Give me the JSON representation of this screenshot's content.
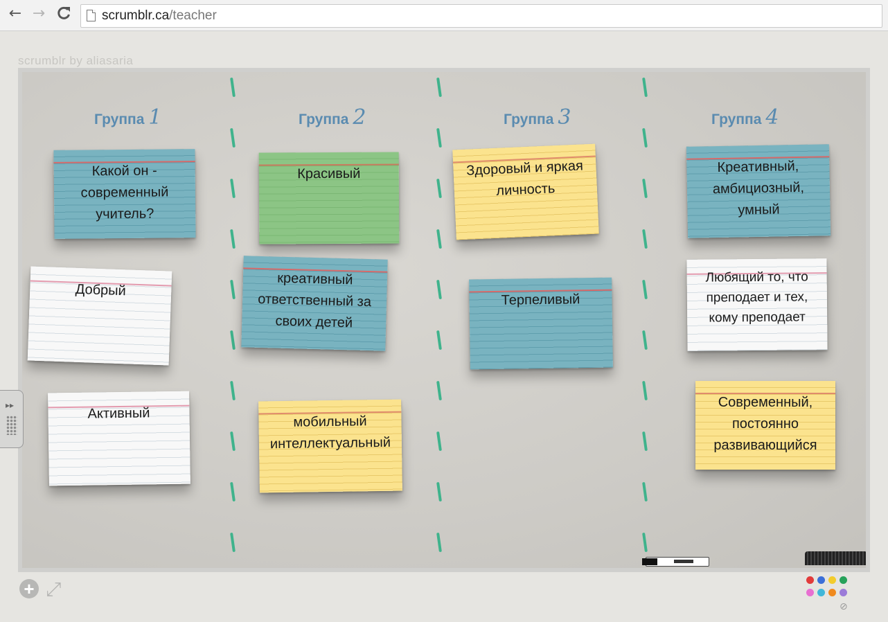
{
  "browser": {
    "url_host": "scrumblr.ca",
    "url_path": "/teacher",
    "back": "←",
    "forward": "→",
    "reload": "C"
  },
  "app": {
    "brand": "scrumblr by aliasaria"
  },
  "columns": [
    {
      "label": "Группа",
      "number": "1"
    },
    {
      "label": "Группа",
      "number": "2"
    },
    {
      "label": "Группа",
      "number": "3"
    },
    {
      "label": "Группа",
      "number": "4"
    }
  ],
  "cards": [
    {
      "color": "blue",
      "lines": [
        "Какой он -",
        "современный",
        "учитель?"
      ]
    },
    {
      "color": "white",
      "lines": [
        "Добрый"
      ]
    },
    {
      "color": "white",
      "lines": [
        "Активный"
      ]
    },
    {
      "color": "green",
      "lines": [
        "Красивый"
      ]
    },
    {
      "color": "blue",
      "lines": [
        "креативный",
        "ответственный за",
        "своих детей"
      ]
    },
    {
      "color": "yellow",
      "lines": [
        "мобильный",
        "интеллектуальный"
      ]
    },
    {
      "color": "yellow",
      "lines": [
        "Здоровый и яркая",
        "личность"
      ]
    },
    {
      "color": "blue",
      "lines": [
        "Терпеливый"
      ]
    },
    {
      "color": "blue",
      "lines": [
        "Креативный,",
        "амбициозный,",
        "умный"
      ]
    },
    {
      "color": "white",
      "lines": [
        "Любящий то, что",
        "преподает и тех,",
        "кому преподает"
      ]
    },
    {
      "color": "yellow",
      "lines": [
        "Современный,",
        "постоянно",
        "развивающийся"
      ]
    }
  ],
  "palette": [
    "#e23b3b",
    "#3b6fd8",
    "#f3cc2c",
    "#27a25a",
    "#e86fd1",
    "#41b7d9",
    "#f08a1e",
    "#9b7bd8"
  ],
  "icons": {
    "add": "+",
    "expand": "⤢",
    "none": "⊘",
    "handle": "▸▸"
  }
}
